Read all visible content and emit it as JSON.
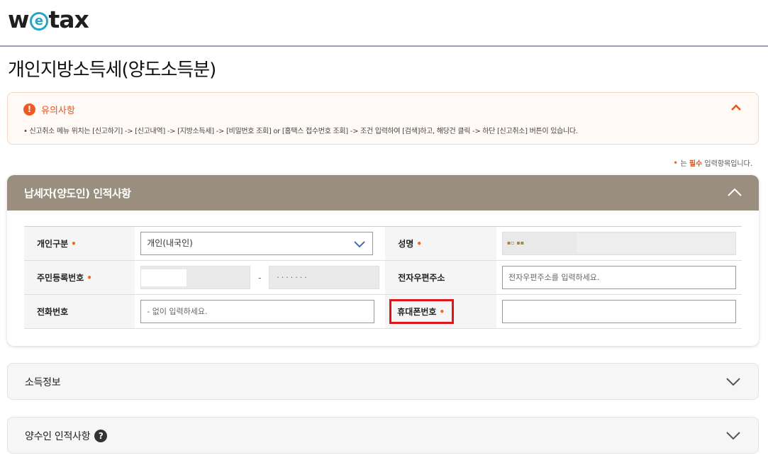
{
  "header": {
    "logo_pre": "w",
    "logo_e": "e",
    "logo_post": "tax"
  },
  "page": {
    "title": "개인지방소득세(양도소득분)"
  },
  "notice": {
    "title": "유의사항",
    "text": "• 신고취소 메뉴 위치는 [신고하기] -> [신고내역] -> [지방소득세] -> [비밀번호 조회] or [홈택스 접수번호 조회] -> 조건 입력하여 [검색]하고, 해당건 클릭 -> 하단 [신고취소] 버튼이 있습니다.",
    "icon": "warning-icon"
  },
  "required_note": {
    "dot": "•",
    "prefix": "는 ",
    "bold": "필수",
    "suffix": " 입력항목입니다."
  },
  "taxpayer_section": {
    "title": "납세자(양도인) 인적사항",
    "fields": {
      "person_type": {
        "label": "개인구분",
        "value": "개인(내국인)"
      },
      "name": {
        "label": "성명",
        "value": "▪▫ ▪▪"
      },
      "ssn": {
        "label": "주민등록번호",
        "dash": "-",
        "masked": "·······"
      },
      "email": {
        "label": "전자우편주소",
        "placeholder": "전자우편주소를 입력하세요."
      },
      "phone": {
        "label": "전화번호",
        "placeholder": "- 없이 입력하세요."
      },
      "mobile": {
        "label": "휴대폰번호"
      }
    },
    "required_mark": "•"
  },
  "income_section": {
    "title": "소득정보"
  },
  "transferee_section": {
    "title": "양수인 인적사항",
    "help": "?"
  },
  "colors": {
    "accent": "#e5531c",
    "section_header": "#9a8f7f",
    "highlight": "#e0141b"
  }
}
